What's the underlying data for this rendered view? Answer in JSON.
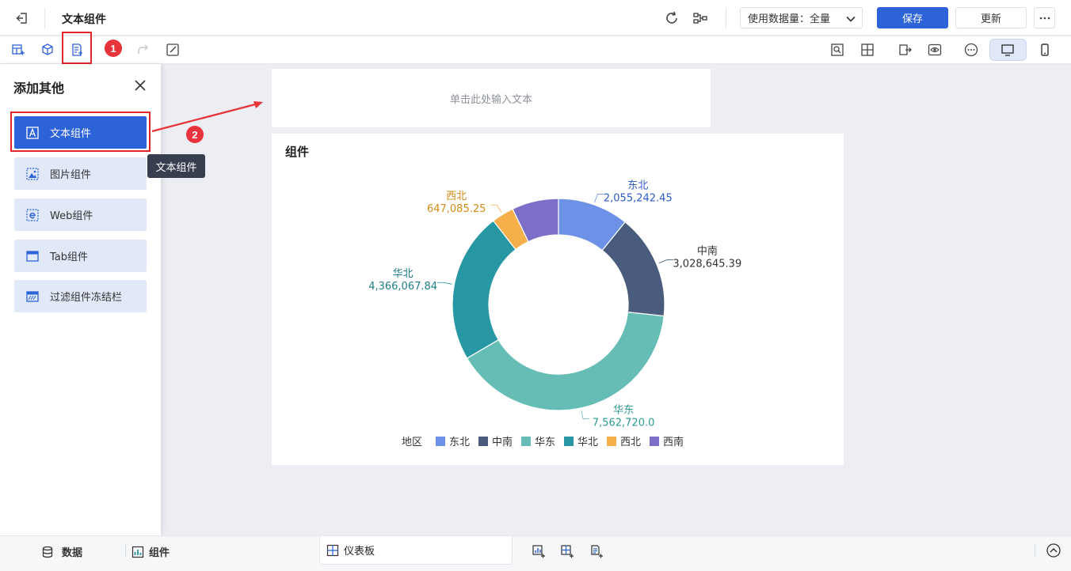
{
  "header": {
    "title": "文本组件",
    "data_usage_label": "使用数据量：全量",
    "save_label": "保存",
    "update_label": "更新"
  },
  "annotations": {
    "step1": "1",
    "step2": "2"
  },
  "side_panel": {
    "title": "添加其他",
    "items": [
      {
        "label": "文本组件",
        "icon": "text-component-icon"
      },
      {
        "label": "图片组件",
        "icon": "image-component-icon"
      },
      {
        "label": "Web组件",
        "icon": "web-component-icon"
      },
      {
        "label": "Tab组件",
        "icon": "tab-component-icon"
      },
      {
        "label": "过滤组件冻结栏",
        "icon": "filter-freeze-icon"
      }
    ],
    "tooltip": "文本组件"
  },
  "canvas": {
    "text_placeholder": "单击此处输入文本",
    "chart_card_title": "组件"
  },
  "chart_data": {
    "type": "pie",
    "variant": "donut",
    "legend_title": "地区",
    "legend_position": "bottom",
    "slices": [
      {
        "name": "东北",
        "value": 2055242.45,
        "label": "2,055,242.45",
        "color": "#6e91e8"
      },
      {
        "name": "中南",
        "value": 3028645.39,
        "label": "3,028,645.39",
        "color": "#4a5c7d"
      },
      {
        "name": "华东",
        "value": 7562720.0,
        "label": "7,562,720.0",
        "color": "#65bdb5"
      },
      {
        "name": "华北",
        "value": 4366067.84,
        "label": "4,366,067.84",
        "color": "#2697a3"
      },
      {
        "name": "西北",
        "value": 647085.25,
        "label": "647,085.25",
        "color": "#f5b04b"
      },
      {
        "name": "西南",
        "value": 1351820.0,
        "label": "",
        "color": "#7b6fc7"
      }
    ]
  },
  "bottom_bar": {
    "data_tab": "数据",
    "component_tab": "组件",
    "dashboard_tab": "仪表板"
  },
  "colors": {
    "accent": "#2d63d8",
    "highlight": "#e0262c",
    "badge": "#e8333a"
  }
}
